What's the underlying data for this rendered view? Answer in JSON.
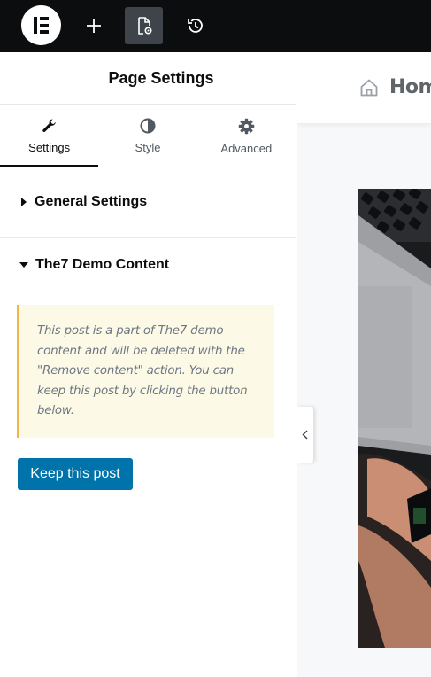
{
  "topbar": {
    "logo_icon": "elementor-logo-icon",
    "add_icon": "plus-icon",
    "page_settings_icon": "page-settings-icon",
    "history_icon": "history-icon"
  },
  "panel": {
    "title": "Page Settings",
    "tabs": [
      {
        "label": "Settings",
        "icon": "wrench-icon",
        "active": true
      },
      {
        "label": "Style",
        "icon": "half-circle-icon",
        "active": false
      },
      {
        "label": "Advanced",
        "icon": "gear-icon",
        "active": false
      }
    ],
    "sections": {
      "general": {
        "title": "General Settings",
        "expanded": false
      },
      "demo": {
        "title": "The7 Demo Content",
        "expanded": true
      }
    },
    "notice": "This post is a part of The7 demo content and will be deleted with the \"Remove content\" action. You can keep this post by clicking the button below.",
    "keep_button": "Keep this post",
    "collapse_icon": "chevron-left-icon"
  },
  "preview": {
    "home_icon": "home-icon",
    "home_text": "Home"
  },
  "colors": {
    "topbar": "#0c0d0e",
    "accent_button": "#0073aa",
    "notice_bg": "#fdf9e7",
    "notice_border": "#f0b849"
  }
}
